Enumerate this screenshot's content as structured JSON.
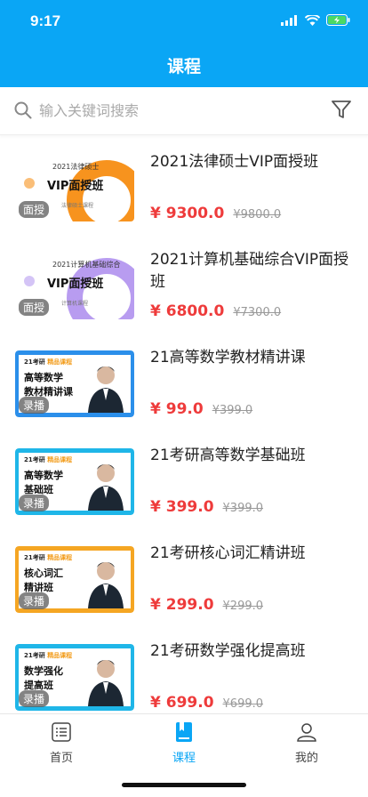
{
  "status_bar": {
    "time": "9:17",
    "icons": [
      "signal-icon",
      "wifi-icon",
      "battery-charging-icon"
    ]
  },
  "header": {
    "title": "课程"
  },
  "search": {
    "placeholder": "输入关键词搜索",
    "icon": "search-icon",
    "filter_icon": "filter-icon"
  },
  "courses": [
    {
      "title": "2021法律硕士VIP面授班",
      "price": "¥ 9300.0",
      "old_price": "¥9800.0",
      "tag": "面授",
      "thumb": {
        "kind": "vip",
        "sub": "2021法律硕士",
        "main": "VIP面授班",
        "small": "法律硕士课程",
        "accent": "#f7931e"
      }
    },
    {
      "title": "2021计算机基础综合VIP面授班",
      "price": "¥ 6800.0",
      "old_price": "¥7300.0",
      "tag": "面授",
      "thumb": {
        "kind": "vip",
        "sub": "2021计算机基础综合",
        "main": "VIP面授班",
        "small": "计算机课程",
        "accent": "#b89cf0"
      }
    },
    {
      "title": "21高等数学教材精讲课",
      "price": "¥ 99.0",
      "old_price": "¥399.0",
      "tag": "录播",
      "thumb": {
        "kind": "rec",
        "brand": "21考研",
        "brand_hl": "精品课程",
        "line1": "高等数学",
        "line2": "教材精讲课",
        "accent": "#2b8fea"
      }
    },
    {
      "title": "21考研高等数学基础班",
      "price": "¥ 399.0",
      "old_price": "¥399.0",
      "tag": "录播",
      "thumb": {
        "kind": "rec",
        "brand": "21考研",
        "brand_hl": "精品课程",
        "line1": "高等数学",
        "line2": "基础班",
        "accent": "#1fb6e8"
      }
    },
    {
      "title": "21考研核心词汇精讲班",
      "price": "¥ 299.0",
      "old_price": "¥299.0",
      "tag": "录播",
      "thumb": {
        "kind": "rec",
        "brand": "21考研",
        "brand_hl": "精品课程",
        "line1": "核心词汇",
        "line2": "精讲班",
        "accent": "#f5a623"
      }
    },
    {
      "title": "21考研数学强化提高班",
      "price": "¥ 699.0",
      "old_price": "¥699.0",
      "tag": "录播",
      "thumb": {
        "kind": "rec",
        "brand": "21考研",
        "brand_hl": "精品课程",
        "line1": "数学强化",
        "line2": "提高班",
        "accent": "#1fb6e8"
      }
    }
  ],
  "tabbar": {
    "items": [
      {
        "label": "首页",
        "icon": "home-list-icon",
        "active": false
      },
      {
        "label": "课程",
        "icon": "book-icon",
        "active": true
      },
      {
        "label": "我的",
        "icon": "user-icon",
        "active": false
      }
    ]
  },
  "colors": {
    "primary": "#0aa6f5",
    "price": "#ee3b3b"
  }
}
